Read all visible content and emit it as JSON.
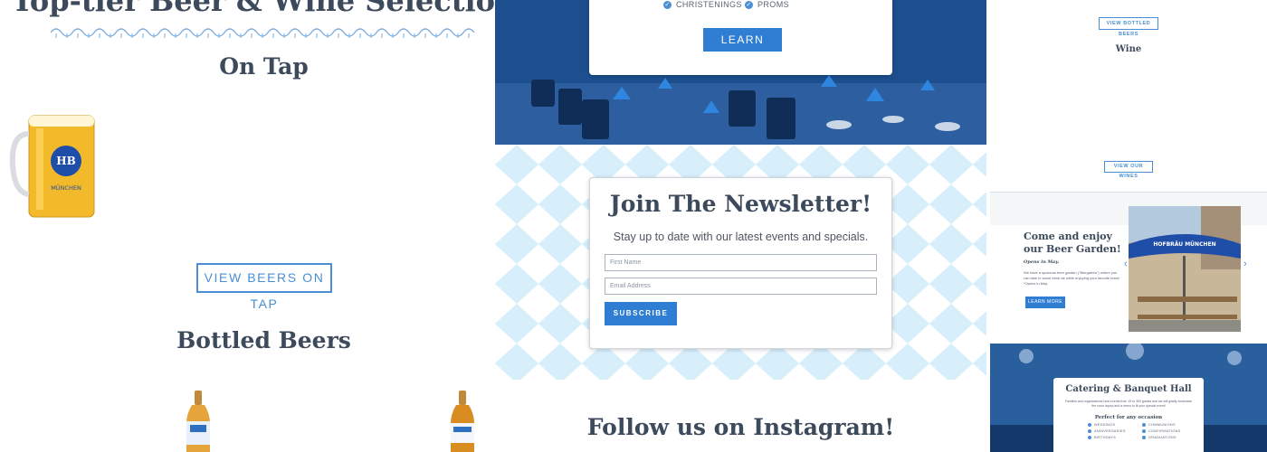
{
  "colors": {
    "accent": "#2f7ed3",
    "heading": "#3d4a5c",
    "banner_blue": "#1b4e8c"
  },
  "left": {
    "section_title": "Top-tier Beer & Wine Selection",
    "on_tap_heading": "On Tap",
    "mug_label": "HB",
    "mug_sublabel": "MÜNCHEN",
    "view_tap_button": "VIEW BEERS ON TAP",
    "bottled_heading": "Bottled Beers"
  },
  "events": {
    "checklist": [
      "CHRISTENINGS",
      "PROMS"
    ],
    "learn_more_button": "LEARN MORE"
  },
  "newsletter": {
    "heading": "Join The Newsletter!",
    "subtext": "Stay up to date with our latest events and specials.",
    "first_name_placeholder": "First Name",
    "email_placeholder": "Email Address",
    "subscribe_button": "SUBSCRIBE"
  },
  "instagram": {
    "heading": "Follow us on Instagram!"
  },
  "sidebar": {
    "view_bottled_button": "VIEW BOTTLED BEERS",
    "wine_heading": "Wine",
    "view_wines_button": "VIEW OUR WINES",
    "garden": {
      "heading": "Come and enjoy our Beer Garden!",
      "opens": "Opens in May.",
      "description": "We have a spacious beer garden (\"Biergarten\") where you can take in some fresh air while enjoying your favorite brew! *Opens in May.",
      "learn_more_button": "LEARN MORE",
      "umbrella_text": "HOFBRÄU MÜNCHEN"
    },
    "hall": {
      "heading": "Catering & Banquet Hall",
      "description": "Families and organizations host events from 15 to 300 guests and we will gladly customize the room layout and a menu to fit your special event!",
      "perfect_for": "Perfect for any occasion",
      "occasions": [
        "WEDDINGS",
        "COMMUNIONS",
        "ANNIVERSARIES",
        "CONFIRMATIONS",
        "BIRTHDAYS",
        "GRADUATIONS"
      ]
    }
  }
}
